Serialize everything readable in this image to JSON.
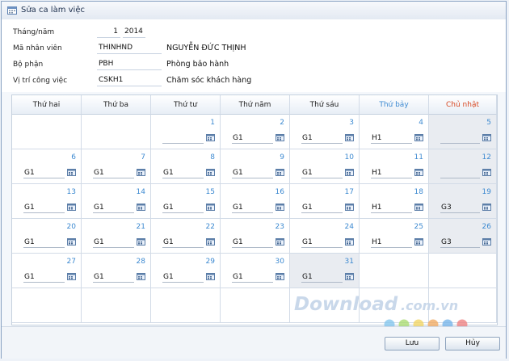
{
  "window": {
    "title": "Sửa ca làm việc"
  },
  "form": {
    "month_year": {
      "label": "Tháng/năm",
      "month": "1",
      "year": "2014"
    },
    "employee_id": {
      "label": "Mã nhân viên",
      "value": "THINHND",
      "name": "NGUYỄN ĐỨC THỊNH"
    },
    "department": {
      "label": "Bộ phận",
      "value": "PBH",
      "name": "Phòng bảo hành"
    },
    "position": {
      "label": "Vị trí công việc",
      "value": "CSKH1",
      "name": "Chăm sóc khách hàng"
    }
  },
  "weekdays": [
    "Thứ hai",
    "Thứ ba",
    "Thứ tư",
    "Thứ năm",
    "Thứ sáu",
    "Thứ bảy",
    "Chủ nhật"
  ],
  "calendar": [
    [
      null,
      null,
      {
        "day": "1",
        "shift": ""
      },
      {
        "day": "2",
        "shift": "G1"
      },
      {
        "day": "3",
        "shift": "G1"
      },
      {
        "day": "4",
        "shift": "H1"
      },
      {
        "day": "5",
        "shift": ""
      }
    ],
    [
      {
        "day": "6",
        "shift": "G1"
      },
      {
        "day": "7",
        "shift": "G1"
      },
      {
        "day": "8",
        "shift": "G1"
      },
      {
        "day": "9",
        "shift": "G1"
      },
      {
        "day": "10",
        "shift": "G1"
      },
      {
        "day": "11",
        "shift": "H1"
      },
      {
        "day": "12",
        "shift": ""
      }
    ],
    [
      {
        "day": "13",
        "shift": "G1"
      },
      {
        "day": "14",
        "shift": "G1"
      },
      {
        "day": "15",
        "shift": "G1"
      },
      {
        "day": "16",
        "shift": "G1"
      },
      {
        "day": "17",
        "shift": "G1"
      },
      {
        "day": "18",
        "shift": "H1"
      },
      {
        "day": "19",
        "shift": "G3"
      }
    ],
    [
      {
        "day": "20",
        "shift": "G1"
      },
      {
        "day": "21",
        "shift": "G1"
      },
      {
        "day": "22",
        "shift": "G1"
      },
      {
        "day": "23",
        "shift": "G1"
      },
      {
        "day": "24",
        "shift": "G1"
      },
      {
        "day": "25",
        "shift": "H1"
      },
      {
        "day": "26",
        "shift": "G3"
      }
    ],
    [
      {
        "day": "27",
        "shift": "G1"
      },
      {
        "day": "28",
        "shift": "G1"
      },
      {
        "day": "29",
        "shift": "G1"
      },
      {
        "day": "30",
        "shift": "G1"
      },
      {
        "day": "31",
        "shift": "G1"
      },
      null,
      null
    ],
    [
      null,
      null,
      null,
      null,
      null,
      null,
      null
    ]
  ],
  "buttons": {
    "save": "Lưu",
    "cancel": "Hủy"
  },
  "watermark": {
    "text": "Download",
    "suffix": ".com.vn",
    "dot_colors": [
      "#7ec3ec",
      "#a5d96a",
      "#f2d35b",
      "#f0a65a",
      "#6fb0e8",
      "#ee7b7b"
    ]
  },
  "colors": {
    "saturday": "#3d8ad1",
    "sunday": "#d84a24",
    "day_number": "#3d8ad1",
    "weekend_bg": "#e9ecf1"
  }
}
